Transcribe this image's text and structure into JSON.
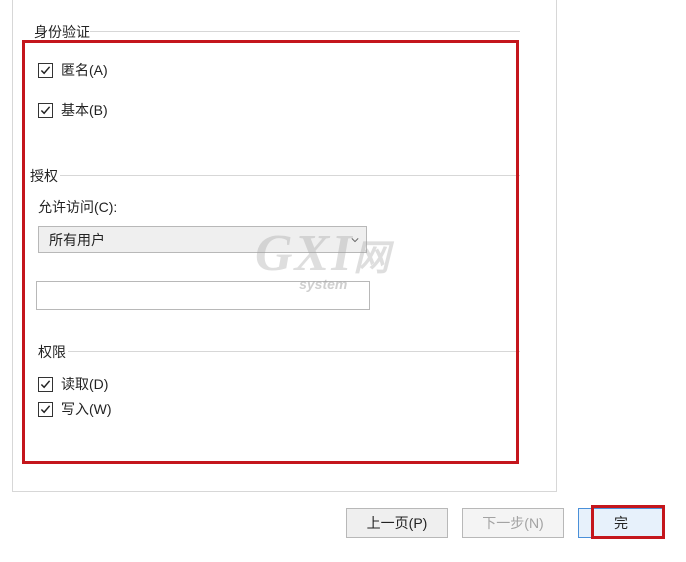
{
  "auth_section": {
    "title": "身份验证",
    "anonymous": {
      "label": "匿名(A)",
      "checked": true
    },
    "basic": {
      "label": "基本(B)",
      "checked": true
    }
  },
  "authz_section": {
    "title": "授权",
    "allow_label": "允许访问(C):",
    "select_value": "所有用户",
    "input_value": ""
  },
  "perm_section": {
    "title": "权限",
    "read": {
      "label": "读取(D)",
      "checked": true
    },
    "write": {
      "label": "写入(W)",
      "checked": true
    }
  },
  "footer": {
    "prev": "上一页(P)",
    "next": "下一步(N)",
    "finish": "完"
  },
  "watermark": {
    "main": "GXI",
    "suffix": "网",
    "sub": "system"
  }
}
